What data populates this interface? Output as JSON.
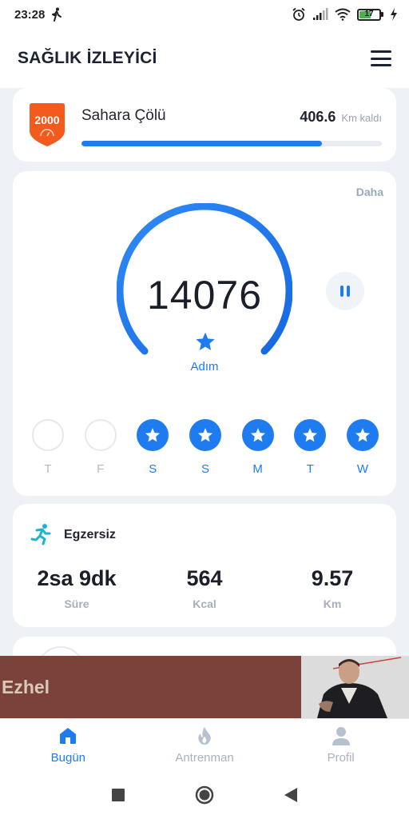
{
  "status_bar": {
    "time": "23:28",
    "battery": "17",
    "icons": [
      "walking-icon",
      "alarm-icon",
      "signal-icon",
      "wifi-icon",
      "battery-icon",
      "charging-icon"
    ]
  },
  "header": {
    "title": "SAĞLIK İZLEYİCİ",
    "menu_icon": "menu-icon"
  },
  "challenge": {
    "badge_number": "2000",
    "name": "Sahara Çölü",
    "remaining_value": "406.6",
    "remaining_unit": "Km kaldı",
    "progress": 0.8,
    "accent": "#1e7cf0",
    "badge_color": "#f25a1e"
  },
  "steps": {
    "more_label": "Daha",
    "value": "14076",
    "unit_label": "Adım",
    "progress": 1.0,
    "pause_icon": "pause-icon",
    "days": [
      {
        "label": "T",
        "done": false
      },
      {
        "label": "F",
        "done": false
      },
      {
        "label": "S",
        "done": true
      },
      {
        "label": "S",
        "done": true
      },
      {
        "label": "M",
        "done": true
      },
      {
        "label": "T",
        "done": true
      },
      {
        "label": "W",
        "done": true
      }
    ]
  },
  "exercise": {
    "title": "Egzersiz",
    "icon": "running-icon",
    "metrics": [
      {
        "value": "2sa 9dk",
        "label": "Süre"
      },
      {
        "value": "564",
        "label": "Kcal"
      },
      {
        "value": "9.57",
        "label": "Km"
      }
    ]
  },
  "ad": {
    "text": "Ezhel",
    "background": "#7a4238"
  },
  "bottom_nav": {
    "items": [
      {
        "label": "Bugün",
        "icon": "home-icon",
        "active": true
      },
      {
        "label": "Antrenman",
        "icon": "flame-icon",
        "active": false
      },
      {
        "label": "Profil",
        "icon": "person-icon",
        "active": false
      }
    ]
  },
  "system_nav": {
    "icons": [
      "recents-square-icon",
      "home-circle-icon",
      "back-triangle-icon"
    ]
  }
}
